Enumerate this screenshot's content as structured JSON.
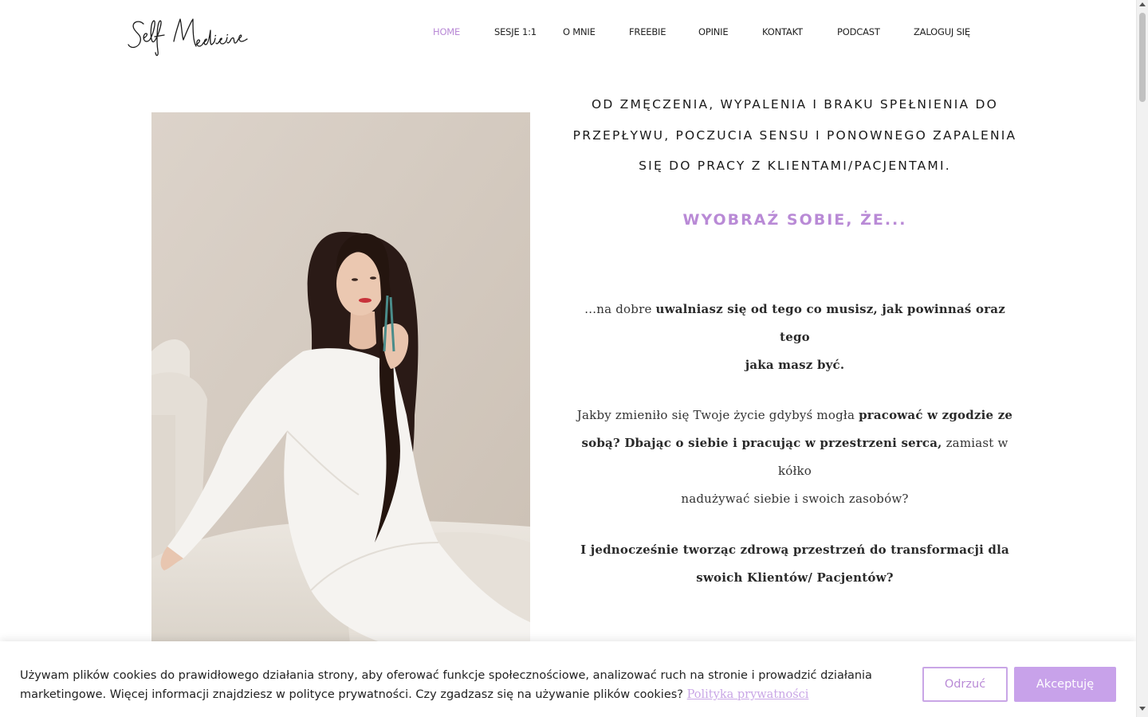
{
  "header": {
    "logo_text": "Self Medicine",
    "nav": [
      {
        "label": "HOME",
        "active": true
      },
      {
        "label": "SESJE 1:1",
        "active": false
      },
      {
        "label": "O MNIE",
        "active": false
      },
      {
        "label": "FREEBIE",
        "active": false
      },
      {
        "label": "OPINIE",
        "active": false
      },
      {
        "label": "KONTAKT",
        "active": false
      },
      {
        "label": "PODCAST",
        "active": false
      },
      {
        "label": "ZALOGUJ SIĘ",
        "active": false
      }
    ]
  },
  "hero": {
    "headline_lines": [
      "OD ZMĘCZENIA, WYPALENIA I BRAKU SPEŁNIENIA DO",
      "PRZEPŁYWU, POCZUCIA SENSU I PONOWNEGO ZAPALENIA",
      "SIĘ DO PRACY Z KLIENTAMI/PACJENTAMI."
    ],
    "subhead": "WYOBRAŹ SOBIE, ŻE...",
    "p1": {
      "l1_a": "…na dobre ",
      "l1_b": "uwalniasz się od tego co musisz, jak powinnaś oraz tego",
      "l2": "jaka masz być."
    },
    "p2": {
      "l1_a": "Jakby zmieniło się Twoje życie gdybyś mogła ",
      "l1_b": "pracować w zgodzie ze",
      "l2_a": "sobą? Dbając o siebie i pracując w przestrzeni serca,",
      "l2_b": " zamiast w kółko",
      "l3": "nadużywać siebie i swoich zasobów?"
    },
    "p3": {
      "l1": "I jednocześnie tworząc zdrową przestrzeń do transformacji dla",
      "l2": "swoich Klientów/ Pacjentów?"
    }
  },
  "cookie": {
    "line1": "Używam plików cookies do prawidłowego działania strony, aby oferować funkcje społecznościowe, analizować ruch na stronie i prowadzić działania",
    "line2": "marketingowe. Więcej informacji znajdziesz w polityce prywatności. Czy zgadzasz się na używanie plików cookies? ",
    "link": "Polityka prywatności",
    "reject_label": "Odrzuć",
    "accept_label": "Akceptuję"
  },
  "colors": {
    "accent": "#b98ad6",
    "accept_button": "#c8a2ea"
  }
}
